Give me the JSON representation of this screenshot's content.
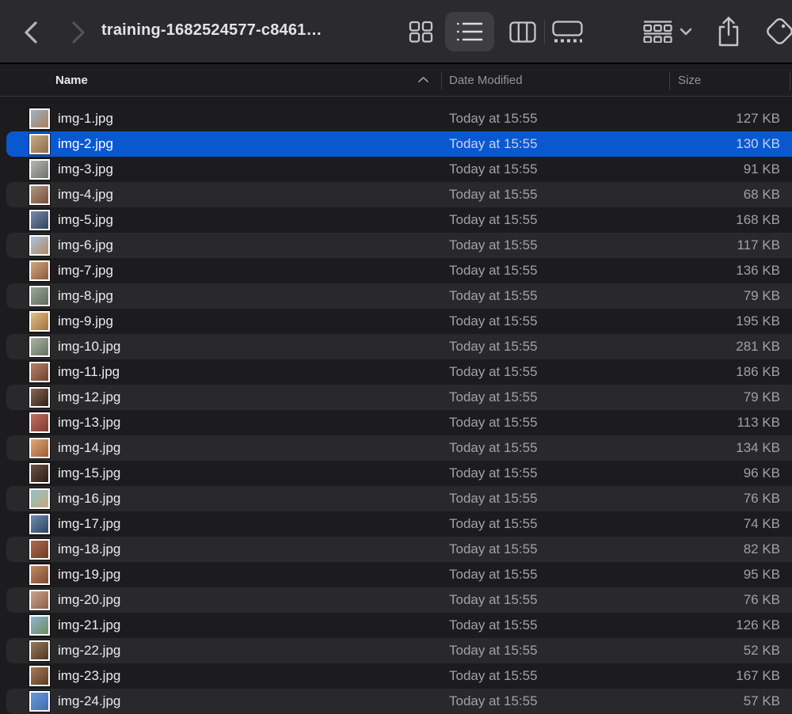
{
  "window": {
    "title": "training-1682524577-c8461…"
  },
  "toolbar": {
    "icons": [
      "chevron-left",
      "chevron-right",
      "icon-view",
      "list-view",
      "column-view",
      "gallery-view",
      "group-by",
      "chevron-down",
      "share",
      "tag"
    ],
    "view_modes": [
      {
        "name": "icon-view",
        "selected": false
      },
      {
        "name": "list-view",
        "selected": true
      },
      {
        "name": "column-view",
        "selected": false
      },
      {
        "name": "gallery-view",
        "selected": false
      }
    ]
  },
  "columns": [
    {
      "label": "Name",
      "sort": "ascending"
    },
    {
      "label": "Date Modified"
    },
    {
      "label": "Size"
    }
  ],
  "selection": {
    "index": 1,
    "color": "#0a58d0"
  },
  "files": [
    {
      "name": "img-1.jpg",
      "date_modified": "Today at 15:55",
      "size": "127 KB",
      "thumb": [
        "#9db3c4",
        "#a97f58"
      ]
    },
    {
      "name": "img-2.jpg",
      "date_modified": "Today at 15:55",
      "size": "130 KB",
      "thumb": [
        "#c7ad87",
        "#8d6b4a"
      ]
    },
    {
      "name": "img-3.jpg",
      "date_modified": "Today at 15:55",
      "size": "91 KB",
      "thumb": [
        "#b7b7b3",
        "#6f6f6b"
      ]
    },
    {
      "name": "img-4.jpg",
      "date_modified": "Today at 15:55",
      "size": "68 KB",
      "thumb": [
        "#a99a85",
        "#7c4a3a"
      ]
    },
    {
      "name": "img-5.jpg",
      "date_modified": "Today at 15:55",
      "size": "168 KB",
      "thumb": [
        "#7a8aa8",
        "#31425f"
      ]
    },
    {
      "name": "img-6.jpg",
      "date_modified": "Today at 15:55",
      "size": "117 KB",
      "thumb": [
        "#a8c4e0",
        "#b08963"
      ]
    },
    {
      "name": "img-7.jpg",
      "date_modified": "Today at 15:55",
      "size": "136 KB",
      "thumb": [
        "#d2a87c",
        "#8a5a3c"
      ]
    },
    {
      "name": "img-8.jpg",
      "date_modified": "Today at 15:55",
      "size": "79 KB",
      "thumb": [
        "#9aa696",
        "#5f6b5c"
      ]
    },
    {
      "name": "img-9.jpg",
      "date_modified": "Today at 15:55",
      "size": "195 KB",
      "thumb": [
        "#e0c08a",
        "#a2713d"
      ]
    },
    {
      "name": "img-10.jpg",
      "date_modified": "Today at 15:55",
      "size": "281 KB",
      "thumb": [
        "#aab2a6",
        "#66725f"
      ]
    },
    {
      "name": "img-11.jpg",
      "date_modified": "Today at 15:55",
      "size": "186 KB",
      "thumb": [
        "#b5826b",
        "#6e4330"
      ]
    },
    {
      "name": "img-12.jpg",
      "date_modified": "Today at 15:55",
      "size": "79 KB",
      "thumb": [
        "#8a674f",
        "#2e211b"
      ]
    },
    {
      "name": "img-13.jpg",
      "date_modified": "Today at 15:55",
      "size": "113 KB",
      "thumb": [
        "#c4705f",
        "#7e3a30"
      ]
    },
    {
      "name": "img-14.jpg",
      "date_modified": "Today at 15:55",
      "size": "134 KB",
      "thumb": [
        "#e0a878",
        "#9c5f35"
      ]
    },
    {
      "name": "img-15.jpg",
      "date_modified": "Today at 15:55",
      "size": "96 KB",
      "thumb": [
        "#6e5244",
        "#2a1d16"
      ]
    },
    {
      "name": "img-16.jpg",
      "date_modified": "Today at 15:55",
      "size": "76 KB",
      "thumb": [
        "#8fc4c6",
        "#c7a87e"
      ]
    },
    {
      "name": "img-17.jpg",
      "date_modified": "Today at 15:55",
      "size": "74 KB",
      "thumb": [
        "#6e8db4",
        "#2f4260"
      ]
    },
    {
      "name": "img-18.jpg",
      "date_modified": "Today at 15:55",
      "size": "82 KB",
      "thumb": [
        "#b06a4e",
        "#6e3a28"
      ]
    },
    {
      "name": "img-19.jpg",
      "date_modified": "Today at 15:55",
      "size": "95 KB",
      "thumb": [
        "#c08a66",
        "#7e4a30"
      ]
    },
    {
      "name": "img-20.jpg",
      "date_modified": "Today at 15:55",
      "size": "76 KB",
      "thumb": [
        "#cfa490",
        "#8a5e46"
      ]
    },
    {
      "name": "img-21.jpg",
      "date_modified": "Today at 15:55",
      "size": "126 KB",
      "thumb": [
        "#8fb4d9",
        "#6e8a58"
      ]
    },
    {
      "name": "img-22.jpg",
      "date_modified": "Today at 15:55",
      "size": "52 KB",
      "thumb": [
        "#9a7a58",
        "#4e3625"
      ]
    },
    {
      "name": "img-23.jpg",
      "date_modified": "Today at 15:55",
      "size": "167 KB",
      "thumb": [
        "#a87c58",
        "#5c3b26"
      ]
    },
    {
      "name": "img-24.jpg",
      "date_modified": "Today at 15:55",
      "size": "57 KB",
      "thumb": [
        "#6a9ad9",
        "#3f6cb0"
      ]
    }
  ]
}
